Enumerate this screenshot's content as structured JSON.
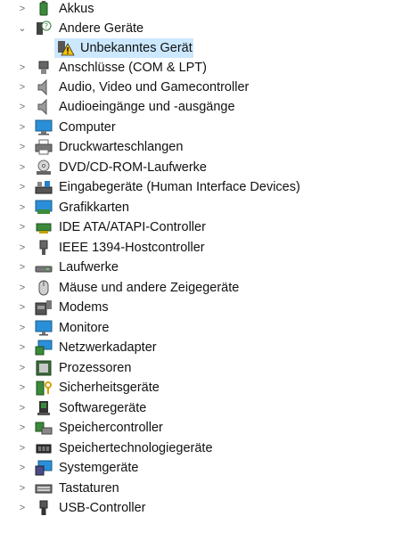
{
  "tree": {
    "items": [
      {
        "label": "Akkus",
        "icon": "battery-icon",
        "expanded": false
      },
      {
        "label": "Andere Geräte",
        "icon": "unknown-device-category-icon",
        "expanded": true
      },
      {
        "label": "Unbekanntes Gerät",
        "icon": "warning-device-icon",
        "child": true,
        "selected": true
      },
      {
        "label": "Anschlüsse (COM & LPT)",
        "icon": "port-icon",
        "expanded": false
      },
      {
        "label": "Audio, Video und Gamecontroller",
        "icon": "speaker-icon",
        "expanded": false
      },
      {
        "label": "Audioeingänge und -ausgänge",
        "icon": "speaker-icon",
        "expanded": false
      },
      {
        "label": "Computer",
        "icon": "computer-icon",
        "expanded": false
      },
      {
        "label": "Druckwarteschlangen",
        "icon": "printer-icon",
        "expanded": false
      },
      {
        "label": "DVD/CD-ROM-Laufwerke",
        "icon": "disc-drive-icon",
        "expanded": false
      },
      {
        "label": "Eingabegeräte (Human Interface Devices)",
        "icon": "hid-icon",
        "expanded": false
      },
      {
        "label": "Grafikkarten",
        "icon": "display-adapter-icon",
        "expanded": false
      },
      {
        "label": "IDE ATA/ATAPI-Controller",
        "icon": "ide-controller-icon",
        "expanded": false
      },
      {
        "label": "IEEE 1394-Hostcontroller",
        "icon": "firewire-icon",
        "expanded": false
      },
      {
        "label": "Laufwerke",
        "icon": "disk-drive-icon",
        "expanded": false
      },
      {
        "label": "Mäuse und andere Zeigegeräte",
        "icon": "mouse-icon",
        "expanded": false
      },
      {
        "label": "Modems",
        "icon": "modem-icon",
        "expanded": false
      },
      {
        "label": "Monitore",
        "icon": "monitor-icon",
        "expanded": false
      },
      {
        "label": "Netzwerkadapter",
        "icon": "network-adapter-icon",
        "expanded": false
      },
      {
        "label": "Prozessoren",
        "icon": "processor-icon",
        "expanded": false
      },
      {
        "label": "Sicherheitsgeräte",
        "icon": "security-device-icon",
        "expanded": false
      },
      {
        "label": "Softwaregeräte",
        "icon": "software-device-icon",
        "expanded": false
      },
      {
        "label": "Speichercontroller",
        "icon": "storage-controller-icon",
        "expanded": false
      },
      {
        "label": "Speichertechnologiegeräte",
        "icon": "memory-technology-icon",
        "expanded": false
      },
      {
        "label": "Systemgeräte",
        "icon": "system-device-icon",
        "expanded": false
      },
      {
        "label": "Tastaturen",
        "icon": "keyboard-icon",
        "expanded": false
      },
      {
        "label": "USB-Controller",
        "icon": "usb-icon",
        "expanded": false
      }
    ]
  },
  "colors": {
    "selection": "#cce8ff",
    "chevron": "#6f6f6f",
    "text": "#111111"
  }
}
